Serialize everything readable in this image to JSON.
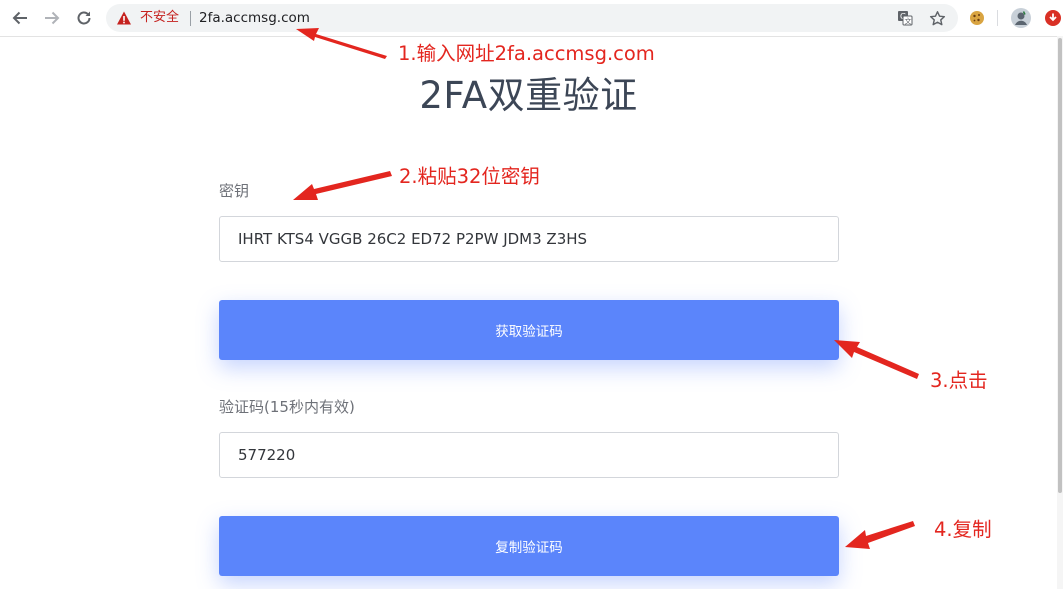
{
  "browser": {
    "security_label": "不安全",
    "url": "2fa.accmsg.com",
    "icons": [
      "back-arrow-icon",
      "forward-arrow-icon",
      "reload-icon",
      "warning-icon",
      "translate-icon",
      "bookmark-star-icon",
      "cookie-extension-icon",
      "profile-avatar-icon",
      "extension-icon"
    ]
  },
  "page": {
    "title": "2FA双重验证",
    "secret": {
      "label": "密钥",
      "value": "IHRT KTS4 VGGB 26C2 ED72 P2PW JDM3 Z3HS"
    },
    "get_code_button": "获取验证码",
    "code": {
      "label": "验证码(15秒内有效)",
      "value": "577220"
    },
    "copy_button": "复制验证码"
  },
  "annotations": {
    "step1": "1.输入网址2fa.accmsg.com",
    "step2": "2.粘贴32位密钥",
    "step3": "3.点击",
    "step4": "4.复制",
    "arrow_color": "#e3261f"
  },
  "colors": {
    "button": "#5b85fb",
    "title": "#3c4656",
    "warning": "#c5221f"
  }
}
